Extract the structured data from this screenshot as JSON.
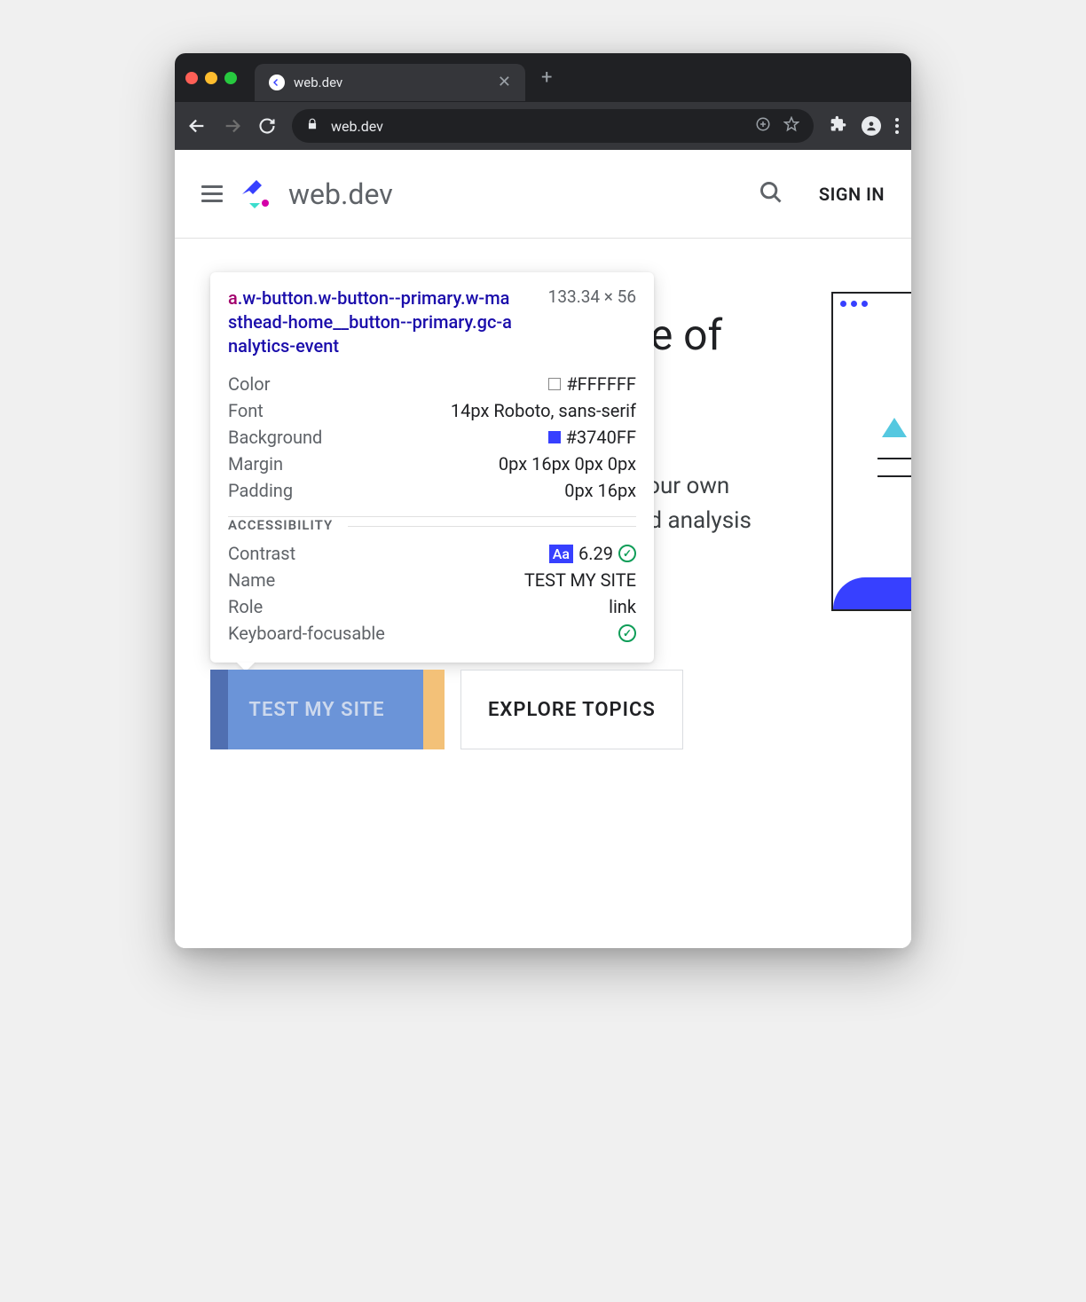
{
  "browser": {
    "tab_title": "web.dev",
    "url": "web.dev"
  },
  "header": {
    "brand": "web.dev",
    "signin": "SIGN IN"
  },
  "hero": {
    "title_fragment": "re of",
    "sub_line1": "your own",
    "sub_line2": "nd analysis"
  },
  "buttons": {
    "primary": "TEST MY SITE",
    "secondary": "EXPLORE TOPICS"
  },
  "tooltip": {
    "tag": "a",
    "selector": ".w-button.w-button--primary.w-masthead-home__button--primary.gc-analytics-event",
    "dimensions": "133.34 × 56",
    "styles": {
      "color_label": "Color",
      "color_value": "#FFFFFF",
      "font_label": "Font",
      "font_value": "14px Roboto, sans-serif",
      "background_label": "Background",
      "background_value": "#3740FF",
      "margin_label": "Margin",
      "margin_value": "0px 16px 0px 0px",
      "padding_label": "Padding",
      "padding_value": "0px 16px"
    },
    "a11y": {
      "section": "ACCESSIBILITY",
      "contrast_label": "Contrast",
      "contrast_badge": "Aa",
      "contrast_value": "6.29",
      "name_label": "Name",
      "name_value": "TEST MY SITE",
      "role_label": "Role",
      "role_value": "link",
      "keyboard_label": "Keyboard-focusable"
    }
  }
}
